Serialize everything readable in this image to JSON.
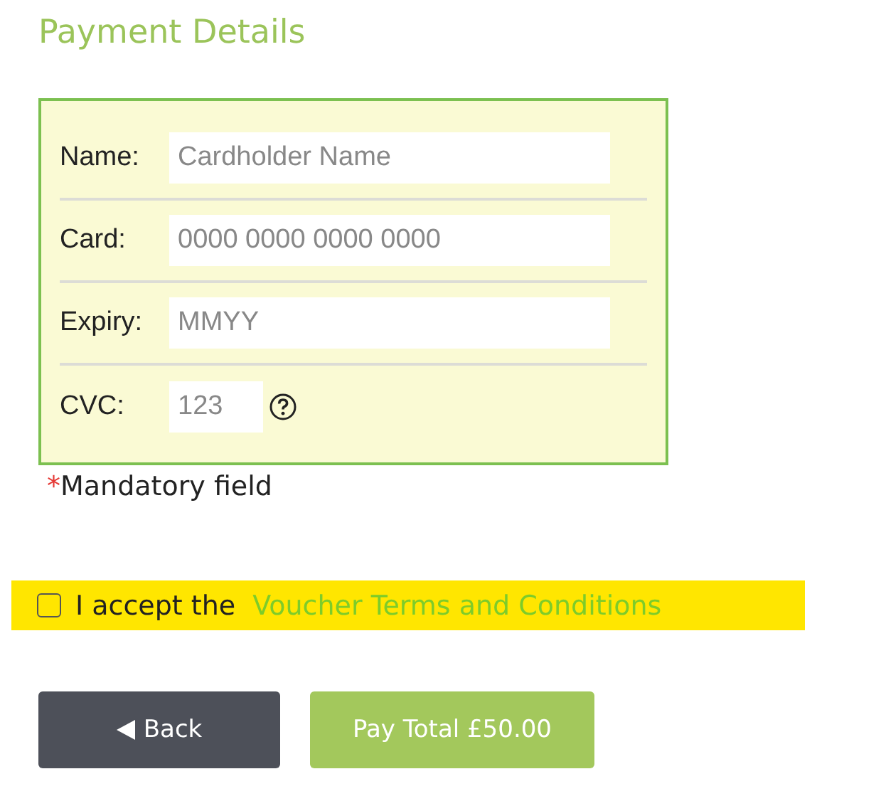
{
  "title": "Payment Details",
  "fields": [
    {
      "label": "Name:",
      "placeholder": "Cardholder Name",
      "kind": "wide",
      "help": false
    },
    {
      "label": "Card:",
      "placeholder": "0000 0000 0000 0000",
      "kind": "wide",
      "help": false
    },
    {
      "label": "Expiry:",
      "placeholder": "MMYY",
      "kind": "wide",
      "help": false
    },
    {
      "label": "CVC:",
      "placeholder": "123",
      "kind": "short",
      "help": true
    }
  ],
  "mandatory": {
    "mark": "*",
    "text": "Mandatory field"
  },
  "terms": {
    "checked": false,
    "text": "I accept the",
    "link": "Voucher Terms and Conditions"
  },
  "buttons": [
    {
      "kind": "back",
      "label": "Back"
    },
    {
      "kind": "primary",
      "label": "Pay Total £50.00"
    }
  ]
}
